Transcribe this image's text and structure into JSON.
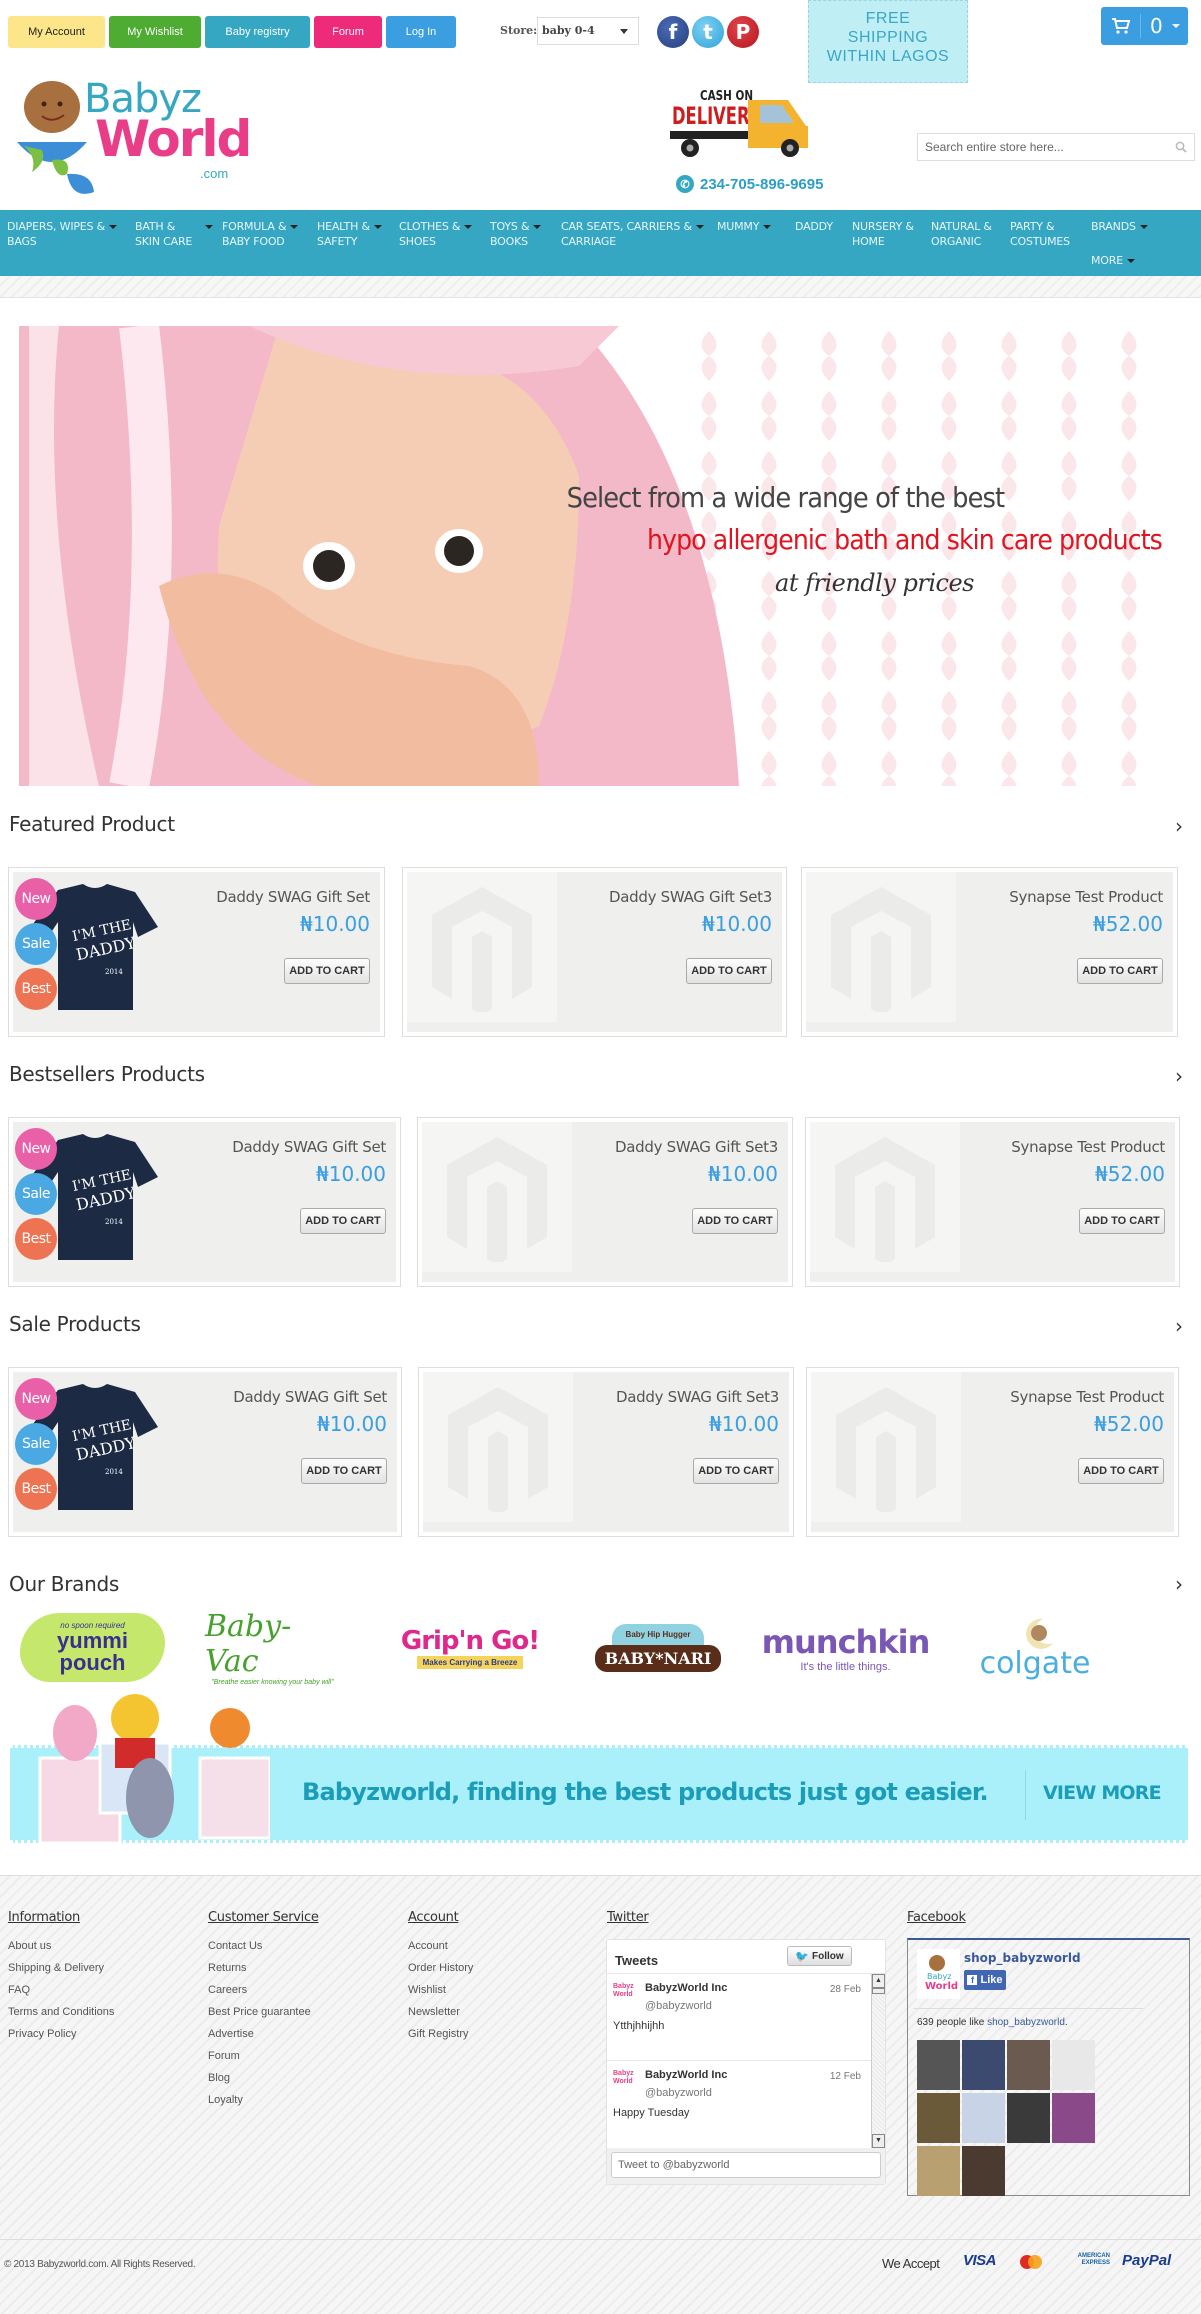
{
  "top_buttons": [
    {
      "label": "My Account",
      "color": "#fde68a",
      "text_color": "#222"
    },
    {
      "label": "My Wishlist",
      "color": "#4eac33",
      "text_color": "#fff"
    },
    {
      "label": "Baby registry",
      "color": "#35a7c2",
      "text_color": "#fff"
    },
    {
      "label": "Forum",
      "color": "#ee2a7b",
      "text_color": "#fff"
    },
    {
      "label": "Log In",
      "color": "#3a9ee0",
      "text_color": "#fff"
    }
  ],
  "store": {
    "label": "Store:",
    "selected": "baby 0-4"
  },
  "social": [
    {
      "name": "facebook",
      "glyph": "f",
      "color": "#2d4b94"
    },
    {
      "name": "twitter",
      "glyph": "t",
      "color": "#3cb0e6"
    },
    {
      "name": "pinterest",
      "glyph": "P",
      "color": "#c9212a"
    }
  ],
  "free_shipping": {
    "line1": "FREE",
    "line2": "SHIPPING",
    "line3": "WITHIN LAGOS"
  },
  "cart": {
    "count": "0"
  },
  "logo": {
    "line1": "Babyz",
    "line2": "World",
    "line3": ".com"
  },
  "cod": {
    "line1": "CASH ON",
    "line2": "DELIVERY"
  },
  "phone": "234-705-896-9695",
  "search": {
    "placeholder": "Search entire store here..."
  },
  "nav": [
    {
      "line1": "DIAPERS, WIPES &",
      "line2": "BAGS",
      "dropdown": true
    },
    {
      "line1": "BATH &",
      "line2": "SKIN CARE",
      "dropdown": true
    },
    {
      "line1": "FORMULA &",
      "line2": "BABY FOOD",
      "dropdown": true
    },
    {
      "line1": "HEALTH &",
      "line2": "SAFETY",
      "dropdown": true
    },
    {
      "line1": "CLOTHES &",
      "line2": "SHOES",
      "dropdown": true
    },
    {
      "line1": "TOYS &",
      "line2": "BOOKS",
      "dropdown": true
    },
    {
      "line1": "CAR SEATS, CARRIERS &",
      "line2": "CARRIAGE",
      "dropdown": true
    },
    {
      "line1": "MUMMY",
      "line2": "",
      "dropdown": true
    },
    {
      "line1": "DADDY",
      "line2": "",
      "dropdown": false
    },
    {
      "line1": "NURSERY &",
      "line2": "HOME",
      "dropdown": false
    },
    {
      "line1": "NATURAL &",
      "line2": "ORGANIC",
      "dropdown": false
    },
    {
      "line1": "PARTY &",
      "line2": "COSTUMES",
      "dropdown": false
    },
    {
      "line1": "BRANDS",
      "line2": "",
      "dropdown": true
    },
    {
      "line1": "MORE",
      "line2": "",
      "dropdown": true
    }
  ],
  "hero": {
    "line1": "Select from a wide range of the best",
    "line2": "hypo allergenic bath and skin care products",
    "line3": "at friendly prices"
  },
  "sections": [
    {
      "title": "Featured Product",
      "products": [
        {
          "name": "Daddy SWAG Gift Set",
          "price": "₦10.00",
          "button": "ADD TO CART",
          "image": "tshirt",
          "badges": [
            "New",
            "Sale",
            "Best"
          ]
        },
        {
          "name": "Daddy SWAG Gift Set3",
          "price": "₦10.00",
          "button": "ADD TO CART",
          "image": "placeholder",
          "badges": []
        },
        {
          "name": "Synapse Test Product",
          "price": "₦52.00",
          "button": "ADD TO CART",
          "image": "placeholder",
          "badges": []
        }
      ]
    },
    {
      "title": "Bestsellers Products",
      "products": [
        {
          "name": "Daddy SWAG Gift Set",
          "price": "₦10.00",
          "button": "ADD TO CART",
          "image": "tshirt",
          "badges": [
            "New",
            "Sale",
            "Best"
          ]
        },
        {
          "name": "Daddy SWAG Gift Set3",
          "price": "₦10.00",
          "button": "ADD TO CART",
          "image": "placeholder",
          "badges": []
        },
        {
          "name": "Synapse Test Product",
          "price": "₦52.00",
          "button": "ADD TO CART",
          "image": "placeholder",
          "badges": []
        }
      ]
    },
    {
      "title": "Sale Products",
      "products": [
        {
          "name": "Daddy SWAG Gift Set",
          "price": "₦10.00",
          "button": "ADD TO CART",
          "image": "tshirt",
          "badges": [
            "New",
            "Sale",
            "Best"
          ]
        },
        {
          "name": "Daddy SWAG Gift Set3",
          "price": "₦10.00",
          "button": "ADD TO CART",
          "image": "placeholder",
          "badges": []
        },
        {
          "name": "Synapse Test Product",
          "price": "₦52.00",
          "button": "ADD TO CART",
          "image": "placeholder",
          "badges": []
        }
      ]
    }
  ],
  "badge_colors": {
    "New": "#e95fa8",
    "Sale": "#4aa8e2",
    "Best": "#ee7352"
  },
  "brands": {
    "title": "Our Brands",
    "items": [
      {
        "name": "yummi pouch",
        "tagline": "no spoon required",
        "color": "#3a2e8f"
      },
      {
        "name": "Baby-Vac",
        "tagline": "\"Breathe easier knowing your baby will\"",
        "color": "#47a12e"
      },
      {
        "name": "Grip'n Go!",
        "tagline": "Makes Carrying a Breeze",
        "color": "#e0288a"
      },
      {
        "name": "BABY*NARI",
        "tagline": "Baby Hip Hugger",
        "color": "#5a2c1a"
      },
      {
        "name": "munchkin",
        "tagline": "It's the little things.",
        "color": "#7a57b5"
      },
      {
        "name": "colgate",
        "tagline": "",
        "color": "#4aaee0"
      }
    ]
  },
  "promo": {
    "text": "Babyzworld, finding the best products just got easier.",
    "cta": "VIEW MORE"
  },
  "footer": {
    "columns": [
      {
        "title": "Information",
        "links": [
          "About us",
          "Shipping & Delivery",
          "FAQ",
          "Terms and Conditions",
          "Privacy Policy"
        ]
      },
      {
        "title": "Customer Service",
        "links": [
          "Contact Us",
          "Returns",
          "Careers",
          "Best Price guarantee",
          "Advertise",
          "Forum",
          "Blog",
          "Loyalty"
        ]
      },
      {
        "title": "Account",
        "links": [
          "Account",
          "Order History",
          "Wishlist",
          "Newsletter",
          "Gift Registry"
        ]
      }
    ],
    "twitter": {
      "title": "Twitter",
      "header": "Tweets",
      "follow": "Follow",
      "tweets": [
        {
          "author": "BabyzWorld Inc",
          "handle": "@babyzworld",
          "date": "28 Feb",
          "text": "Ytthjhhijhh"
        },
        {
          "author": "BabyzWorld Inc",
          "handle": "@babyzworld",
          "date": "12 Feb",
          "text": "Happy Tuesday"
        }
      ],
      "compose_placeholder": "Tweet to @babyzworld"
    },
    "facebook": {
      "title": "Facebook",
      "page": "shop_babyzworld",
      "like": "Like",
      "count_text": "639 people like ",
      "count_link": "shop_babyzworld",
      "faces": 10
    },
    "copyright": "© 2013 Babyzworld.com. All Rights Reserved.",
    "we_accept": "We Accept",
    "payments": [
      "VISA",
      "MasterCard",
      "AMERICAN EXPRESS",
      "PayPal"
    ]
  }
}
